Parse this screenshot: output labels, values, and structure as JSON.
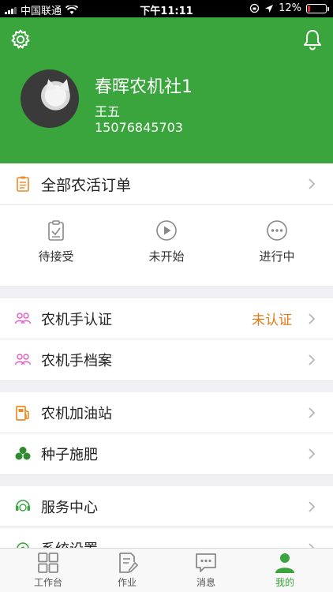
{
  "status_bar": {
    "carrier": "中国联通",
    "time": "下午11:11",
    "battery": "12%",
    "battery_level": 0.12
  },
  "header": {
    "name": "春晖农机社1",
    "subname": "王五",
    "phone": "15076845703"
  },
  "orders": {
    "title": "全部农活订单"
  },
  "quick_actions": [
    {
      "label": "待接受",
      "icon": "clipboard-check-icon"
    },
    {
      "label": "未开始",
      "icon": "play-circle-icon"
    },
    {
      "label": "进行中",
      "icon": "ellipsis-circle-icon"
    }
  ],
  "menu": {
    "driver_cert": {
      "label": "农机手认证",
      "status": "未认证"
    },
    "driver_archive": {
      "label": "农机手档案"
    },
    "gas_station": {
      "label": "农机加油站"
    },
    "seed_fertilizer": {
      "label": "种子施肥"
    },
    "service_center": {
      "label": "服务中心"
    },
    "system_settings": {
      "label": "系统设置"
    }
  },
  "tabbar": [
    {
      "label": "工作台",
      "icon": "grid-icon"
    },
    {
      "label": "作业",
      "icon": "edit-document-icon"
    },
    {
      "label": "消息",
      "icon": "message-icon"
    },
    {
      "label": "我的",
      "icon": "user-icon",
      "active": true
    }
  ],
  "colors": {
    "brand": "#3aa53c",
    "warning": "#e07b17",
    "orange_icon": "#f08a24",
    "pink_icon": "#e45bc5",
    "tab_inactive": "#8a8a8a"
  }
}
